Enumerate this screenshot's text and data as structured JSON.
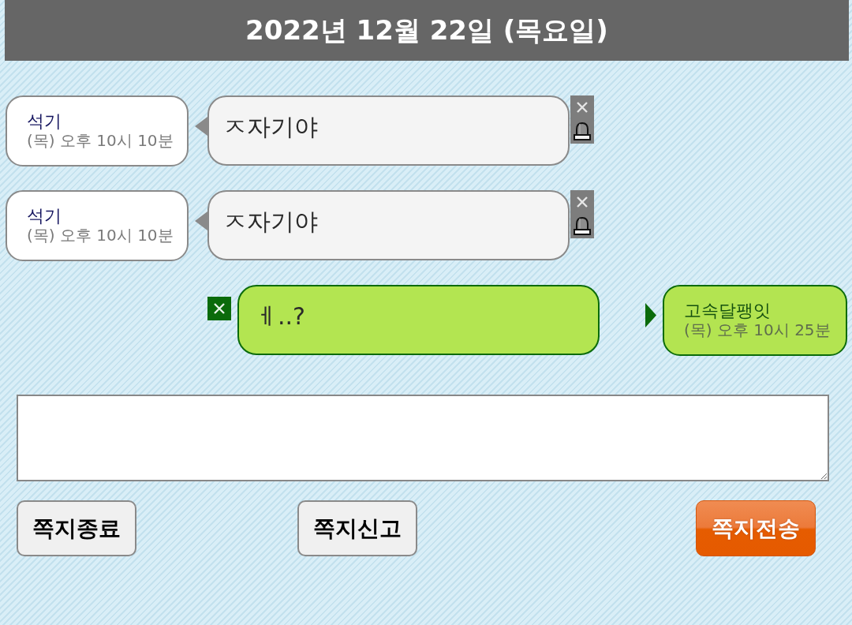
{
  "header": {
    "date": "2022년 12월 22일 (목요일)"
  },
  "messages": [
    {
      "kind": "received",
      "sender": "석기",
      "time": "(목) 오후 10시 10분",
      "text": "ㅈ자기야"
    },
    {
      "kind": "received",
      "sender": "석기",
      "time": "(목) 오후 10시 10분",
      "text": "ㅈ자기야"
    },
    {
      "kind": "sent",
      "sender": "고속달팽잇",
      "time": "(목) 오후 10시 25분",
      "text": "ㅔ..?"
    }
  ],
  "buttons": [
    {
      "label": "쪽지종료",
      "kind": "plain"
    },
    {
      "label": "쪽지신고",
      "kind": "plain"
    },
    {
      "label": "쪽지전송",
      "kind": "primary"
    }
  ]
}
